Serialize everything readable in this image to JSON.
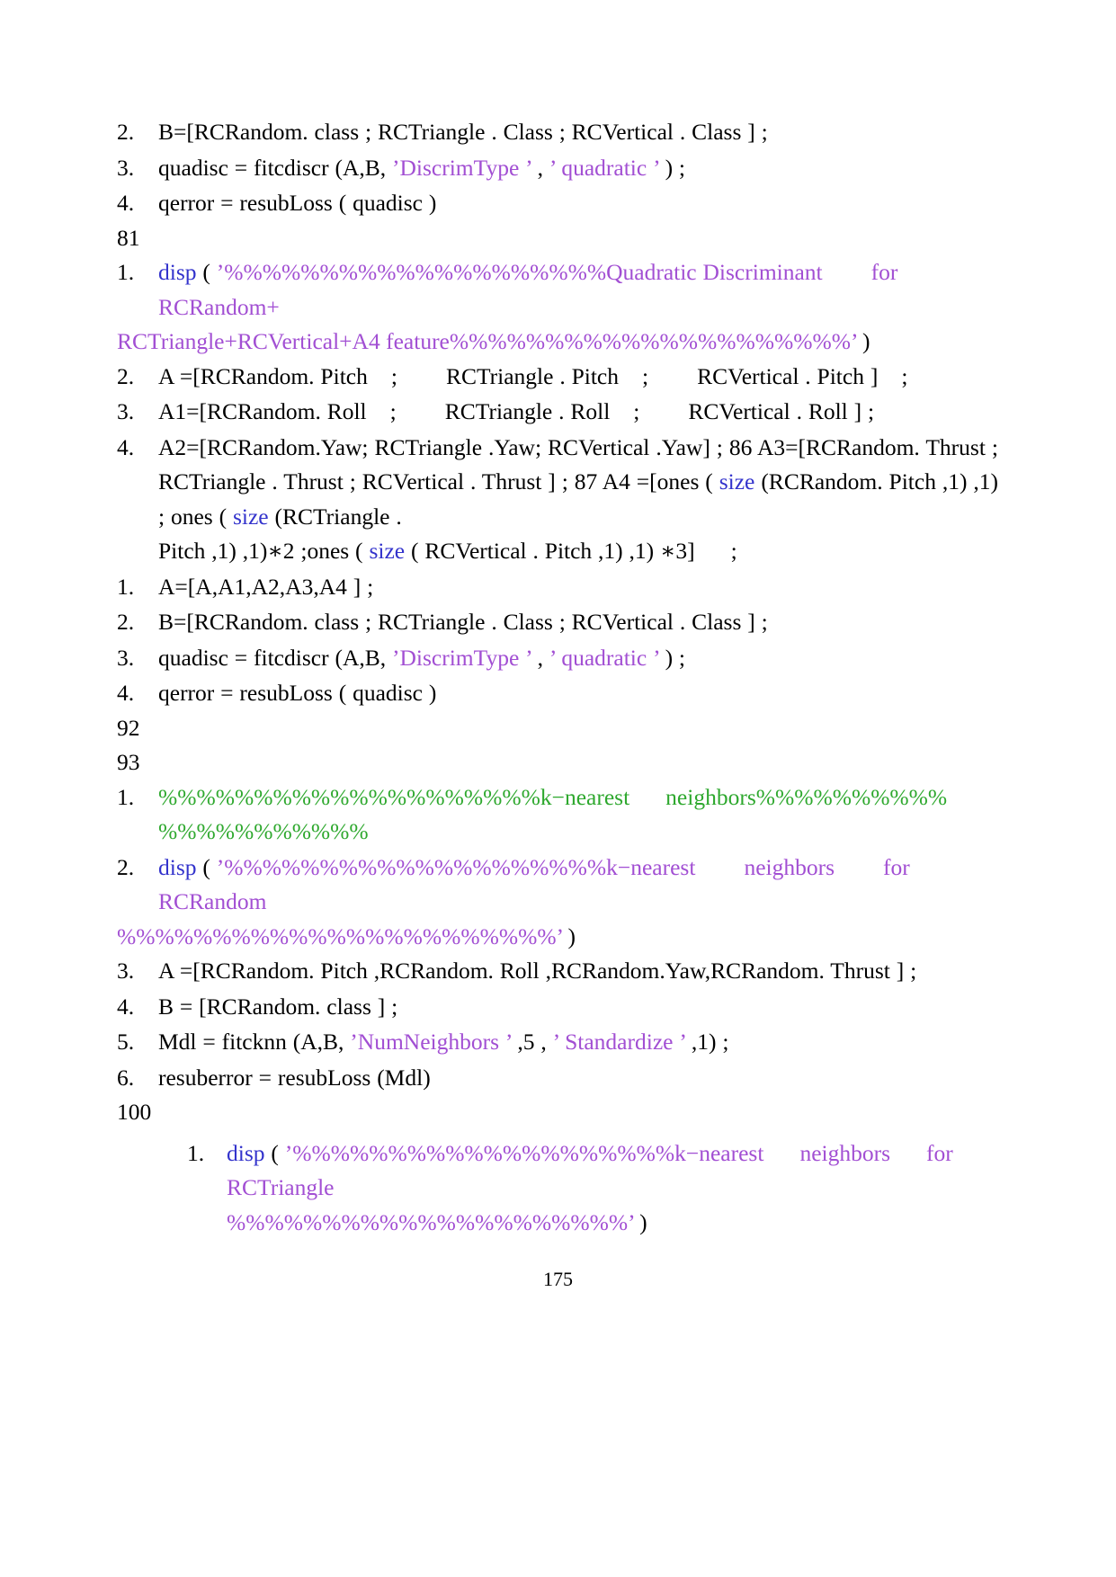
{
  "page": {
    "number": "175",
    "colors": {
      "keyword": "#3333CC",
      "string": "#A24FD3",
      "comment": "#2EA82E",
      "text": "#000000",
      "background": "#ffffff"
    }
  },
  "lines": {
    "l1_num": "2.",
    "l1_text": "B=[RCRandom. class ; RCTriangle . Class ; RCVertical . Class ] ;",
    "l2_num": "3.",
    "l2_a": "quadisc = fitcdiscr (A,B,",
    "l2_str1": "’DiscrimType ’",
    "l2_b": ",",
    "l2_str2": "’ quadratic ’",
    "l2_c": ") ;",
    "l3_num": "4.",
    "l3_text": "qerror = resubLoss ( quadisc )",
    "ln81": "81",
    "l4_num": "1.",
    "l4_kw": "disp",
    "l4_paren": "(",
    "l4_str": "’%%%%%%%%%%%%%%%%%%%%Quadratic Discriminant",
    "l4_for": "for",
    "l4_cont": "RCRandom+",
    "l4_wide": "RCTriangle+RCVertical+A4 feature%%%%%%%%%%%%%%%%%%%%%’",
    "l4_close": ")",
    "l5_num": "2.",
    "l5_a": "A =[RCRandom. Pitch",
    "l5_b": ";",
    "l5_c": "RCTriangle . Pitch",
    "l5_d": ";",
    "l5_e": "RCVertical . Pitch ]",
    "l5_f": ";",
    "l6_num": "3.",
    "l6_a": "A1=[RCRandom. Roll",
    "l6_b": ";",
    "l6_c": "RCTriangle . Roll",
    "l6_d": ";",
    "l6_e": "RCVertical . Roll ] ;",
    "l7_num": "4.",
    "l7_a": "A2=[RCRandom.Yaw;  RCTriangle  .Yaw;  RCVertical  .Yaw]  ;  86  A3=[RCRandom. Thrust ; RCTriangle . Thrust ; RCVertical . Thrust ] ; 87 A4 =[ones (",
    "l7_kw1": "size",
    "l7_b": "(RCRandom. Pitch ,1) ,1) ; ones (",
    "l7_kw2": "size",
    "l7_c": "(RCTriangle .",
    "l7_d": "Pitch ,1) ,1)∗2 ;ones (",
    "l7_kw3": "size",
    "l7_e": "( RCVertical . Pitch ,1) ,1) ∗3]",
    "l7_f": ";",
    "l8_num": "1.",
    "l8_text": "A=[A,A1,A2,A3,A4 ] ;",
    "l9_num": "2.",
    "l9_text": "B=[RCRandom. class ; RCTriangle . Class ; RCVertical . Class ] ;",
    "l10_num": "3.",
    "l10_a": "quadisc = fitcdiscr (A,B,",
    "l10_str1": "’DiscrimType ’",
    "l10_b": ",",
    "l10_str2": "’ quadratic ’",
    "l10_c": ") ;",
    "l11_num": "4.",
    "l11_text": "qerror = resubLoss ( quadisc )",
    "ln92": "92",
    "ln93": "93",
    "l12_num": "1.",
    "l12_cmt_a": "%%%%%%%%%%%%%%%%%%%%k−nearest",
    "l12_cmt_b": "neighbors%%%%%%%%%%",
    "l12_cmt_c": "%%%%%%%%%%%",
    "l13_num": "2.",
    "l13_kw": "disp",
    "l13_paren": "(",
    "l13_str": "’%%%%%%%%%%%%%%%%%%%%k−nearest",
    "l13_nb": "neighbors",
    "l13_for": "for",
    "l13_cont": "RCRandom",
    "l13_wide": "%%%%%%%%%%%%%%%%%%%%%%%’",
    "l13_close": ")",
    "l14_num": "3.",
    "l14_text": "A =[RCRandom. Pitch ,RCRandom. Roll ,RCRandom.Yaw,RCRandom. Thrust ] ;",
    "l15_num": "4.",
    "l15_text": "B = [RCRandom. class ] ;",
    "l16_num": "5.",
    "l16_a": "Mdl = fitcknn (A,B,",
    "l16_str1": "’NumNeighbors ’",
    "l16_b": ",5 ,",
    "l16_str2": "’ Standardize ’",
    "l16_c": ",1) ;",
    "l17_num": "6.",
    "l17_text": "resuberror = resubLoss (Mdl)",
    "ln100": "100",
    "l18_num": "1.",
    "l18_kw": "disp",
    "l18_paren": "(",
    "l18_str": "’%%%%%%%%%%%%%%%%%%%%k−nearest",
    "l18_nb": "neighbors",
    "l18_for": "for",
    "l18_cont": "RCTriangle",
    "l18_wide": "%%%%%%%%%%%%%%%%%%%%%’",
    "l18_close": ")"
  }
}
